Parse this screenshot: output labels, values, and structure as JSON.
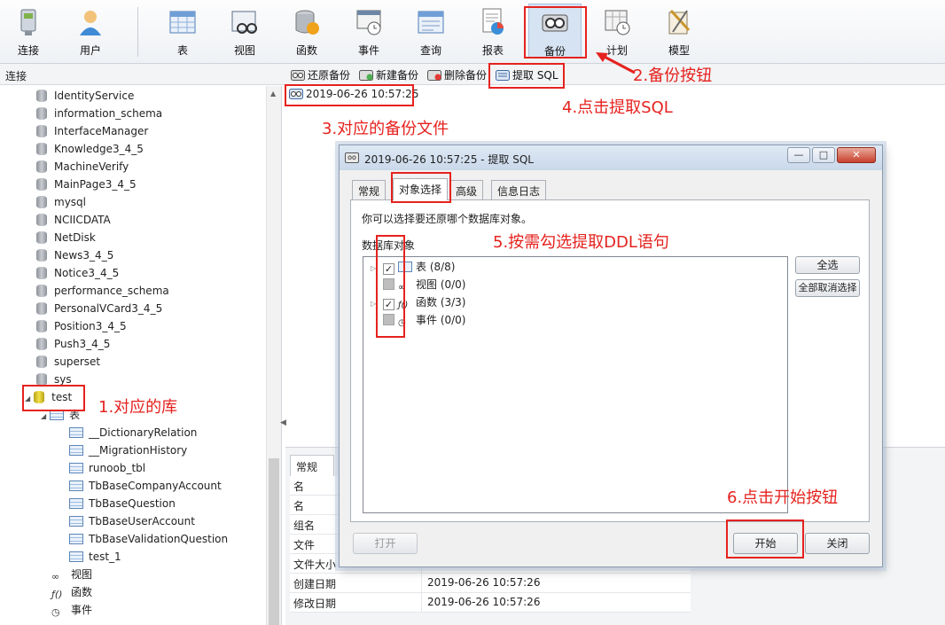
{
  "toolbar": {
    "items": [
      {
        "label": "连接",
        "icon": "connection-icon"
      },
      {
        "label": "用户",
        "icon": "user-icon"
      },
      {
        "label": "表",
        "icon": "table-icon"
      },
      {
        "label": "视图",
        "icon": "view-icon"
      },
      {
        "label": "函数",
        "icon": "function-icon"
      },
      {
        "label": "事件",
        "icon": "event-icon"
      },
      {
        "label": "查询",
        "icon": "query-icon"
      },
      {
        "label": "报表",
        "icon": "report-icon"
      },
      {
        "label": "备份",
        "icon": "backup-icon"
      },
      {
        "label": "计划",
        "icon": "schedule-icon"
      },
      {
        "label": "模型",
        "icon": "model-icon"
      }
    ]
  },
  "subbar": {
    "connection_label": "连接",
    "actions": [
      {
        "label": "还原备份",
        "icon": "restore-icon"
      },
      {
        "label": "新建备份",
        "icon": "new-backup-icon"
      },
      {
        "label": "删除备份",
        "icon": "delete-backup-icon"
      },
      {
        "label": "提取 SQL",
        "icon": "extract-sql-icon"
      }
    ]
  },
  "tree": {
    "databases": [
      "IdentityService",
      "information_schema",
      "InterfaceManager",
      "Knowledge3_4_5",
      "MachineVerify",
      "MainPage3_4_5",
      "mysql",
      "NCIICDATA",
      "NetDisk",
      "News3_4_5",
      "Notice3_4_5",
      "performance_schema",
      "PersonalVCard3_4_5",
      "Position3_4_5",
      "Push3_4_5",
      "superset",
      "sys"
    ],
    "active_db": "test",
    "tables_node": "表",
    "tables": [
      "__DictionaryRelation",
      "__MigrationHistory",
      "runoob_tbl",
      "TbBaseCompanyAccount",
      "TbBaseQuestion",
      "TbBaseUserAccount",
      "TbBaseValidationQuestion",
      "test_1"
    ],
    "other_nodes": [
      "视图",
      "函数",
      "事件"
    ]
  },
  "content": {
    "backup_file": "2019-06-26 10:57:25",
    "lower_tab": "常规",
    "properties": [
      {
        "key": "名",
        "value": ""
      },
      {
        "key": "名",
        "value": ""
      },
      {
        "key": "组名",
        "value": ""
      },
      {
        "key": "文件",
        "value": ""
      },
      {
        "key": "文件大小",
        "value": ""
      },
      {
        "key": "创建日期",
        "value": "2019-06-26 10:57:26"
      },
      {
        "key": "修改日期",
        "value": "2019-06-26 10:57:26"
      }
    ]
  },
  "dialog": {
    "title": "2019-06-26 10:57:25 - 提取 SQL",
    "tabs": [
      "常规",
      "对象选择",
      "高级",
      "信息日志"
    ],
    "active_tab": "对象选择",
    "hint": "你可以选择要还原哪个数据库对象。",
    "objects_label": "数据库对象",
    "objects": [
      {
        "label": "表 (8/8)",
        "checked": true,
        "icon": "table-icon"
      },
      {
        "label": "视图 (0/0)",
        "checked": false,
        "icon": "view-icon"
      },
      {
        "label": "函数 (3/3)",
        "checked": true,
        "icon": "function-icon"
      },
      {
        "label": "事件 (0/0)",
        "checked": false,
        "icon": "event-icon"
      }
    ],
    "select_all": "全选",
    "deselect_all": "全部取消选择",
    "open_button": "打开",
    "start_button": "开始",
    "close_button": "关闭"
  },
  "annotations": {
    "a1": "1.对应的库",
    "a2": "2.备份按钮",
    "a3": "3.对应的备份文件",
    "a4": "4.点击提取SQL",
    "a5": "5.按需勾选提取DDL语句",
    "a6": "6.点击开始按钮"
  },
  "colors": {
    "annotation": "#e5221e",
    "active_db_icon": "#f4e14a"
  }
}
